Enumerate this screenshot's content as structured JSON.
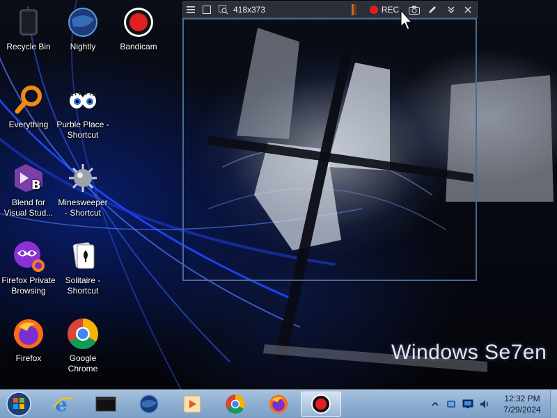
{
  "desktop": {
    "brand_text": "Windows Se7en",
    "icons": [
      {
        "label": "Recycle Bin",
        "icon": "recycle-bin-icon"
      },
      {
        "label": "Nightly",
        "icon": "nightly-icon"
      },
      {
        "label": "Bandicam",
        "icon": "bandicam-icon"
      },
      {
        "label": "Everything",
        "icon": "everything-search-icon"
      },
      {
        "label": "Purble Place - Shortcut",
        "icon": "purble-place-icon"
      },
      {
        "label": "Blend for Visual Stud...",
        "icon": "blend-icon"
      },
      {
        "label": "Minesweeper - Shortcut",
        "icon": "minesweeper-icon"
      },
      {
        "label": "Firefox Private Browsing",
        "icon": "firefox-private-icon"
      },
      {
        "label": "Solitaire - Shortcut",
        "icon": "solitaire-icon"
      },
      {
        "label": "Firefox",
        "icon": "firefox-icon"
      },
      {
        "label": "Google Chrome",
        "icon": "chrome-icon"
      }
    ]
  },
  "capture": {
    "size_text": "418x373",
    "rec_label": "REC"
  },
  "taskbar": {
    "apps": [
      "start-orb",
      "internet-explorer",
      "cmd",
      "nightly",
      "media-player",
      "chrome",
      "firefox",
      "bandicam"
    ],
    "clock": {
      "time": "12:32 PM",
      "date": "7/29/2024"
    }
  },
  "colors": {
    "rec_red": "#e02020",
    "taskbar": "#8fb0d3",
    "frame": "#4b6b93"
  }
}
